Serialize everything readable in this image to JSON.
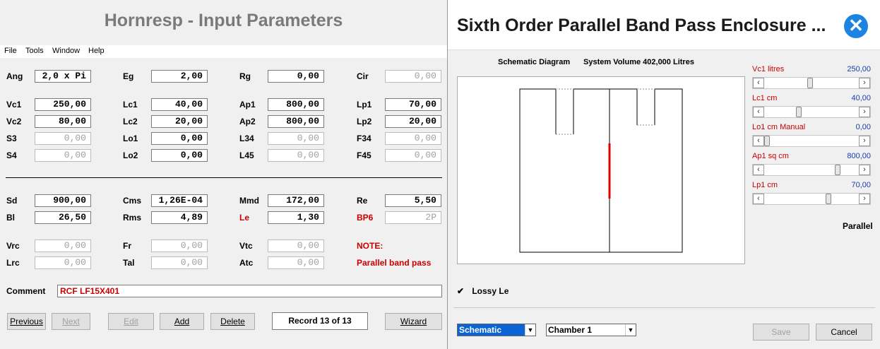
{
  "main": {
    "title": "Hornresp - Input Parameters",
    "menu": [
      "File",
      "Tools",
      "Window",
      "Help"
    ],
    "rows1": [
      {
        "label": "Ang",
        "value": "2,0 x Pi",
        "disabled": false
      },
      {
        "label": "Eg",
        "value": "2,00",
        "disabled": false
      },
      {
        "label": "Rg",
        "value": "0,00",
        "disabled": false
      },
      {
        "label": "Cir",
        "value": "0,00",
        "disabled": true
      }
    ],
    "fields": {
      "Vc1": "250,00",
      "Lc1": "40,00",
      "Ap1": "800,00",
      "Lp1": "70,00",
      "Vc2": "80,00",
      "Lc2": "20,00",
      "Ap2": "800,00",
      "Lp2": "20,00",
      "S3": "0,00",
      "Lo1": "0,00",
      "L34": "0,00",
      "F34": "0,00",
      "S4": "0,00",
      "Lo2": "0,00",
      "L45": "0,00",
      "F45": "0,00",
      "Sd": "900,00",
      "Cms": "1,26E-04",
      "Mmd": "172,00",
      "Re": "5,50",
      "Bl": "26,50",
      "Rms": "4,89",
      "Le": "1,30",
      "BP6": "2P",
      "Vrc": "0,00",
      "Fr": "0,00",
      "Vtc": "0,00",
      "Lrc": "0,00",
      "Tal": "0,00",
      "Atc": "0,00"
    },
    "note_label": "NOTE:",
    "note_text": "Parallel band pass",
    "comment_label": "Comment",
    "comment_value": "RCF LF15X401",
    "buttons": {
      "previous": "Previous",
      "next": "Next",
      "edit": "Edit",
      "add": "Add",
      "delete": "Delete",
      "wizard": "Wizard"
    },
    "record": "Record 13 of 13"
  },
  "dialog": {
    "title": "Sixth Order Parallel Band Pass Enclosure ...",
    "header_left": "Schematic Diagram",
    "header_right": "System Volume 402,000 Litres",
    "sliders": [
      {
        "label": "Vc1  litres",
        "value": "250,00",
        "position": 0.48
      },
      {
        "label": "Lc1  cm",
        "value": "40,00",
        "position": 0.35
      },
      {
        "label": "Lo1  cm  Manual",
        "value": "0,00",
        "position": 0.0
      },
      {
        "label": "Ap1  sq cm",
        "value": "800,00",
        "position": 0.78
      },
      {
        "label": "Lp1  cm",
        "value": "70,00",
        "position": 0.68
      }
    ],
    "mode_label": "Parallel",
    "lossy_label": "Lossy Le",
    "lossy_checked": true,
    "view_select": "Schematic",
    "chamber_select": "Chamber 1",
    "save": "Save",
    "cancel": "Cancel",
    "colors": {
      "accent": "#1b84e0",
      "label_red": "#cc0000",
      "value_blue": "#1a3db0"
    }
  }
}
